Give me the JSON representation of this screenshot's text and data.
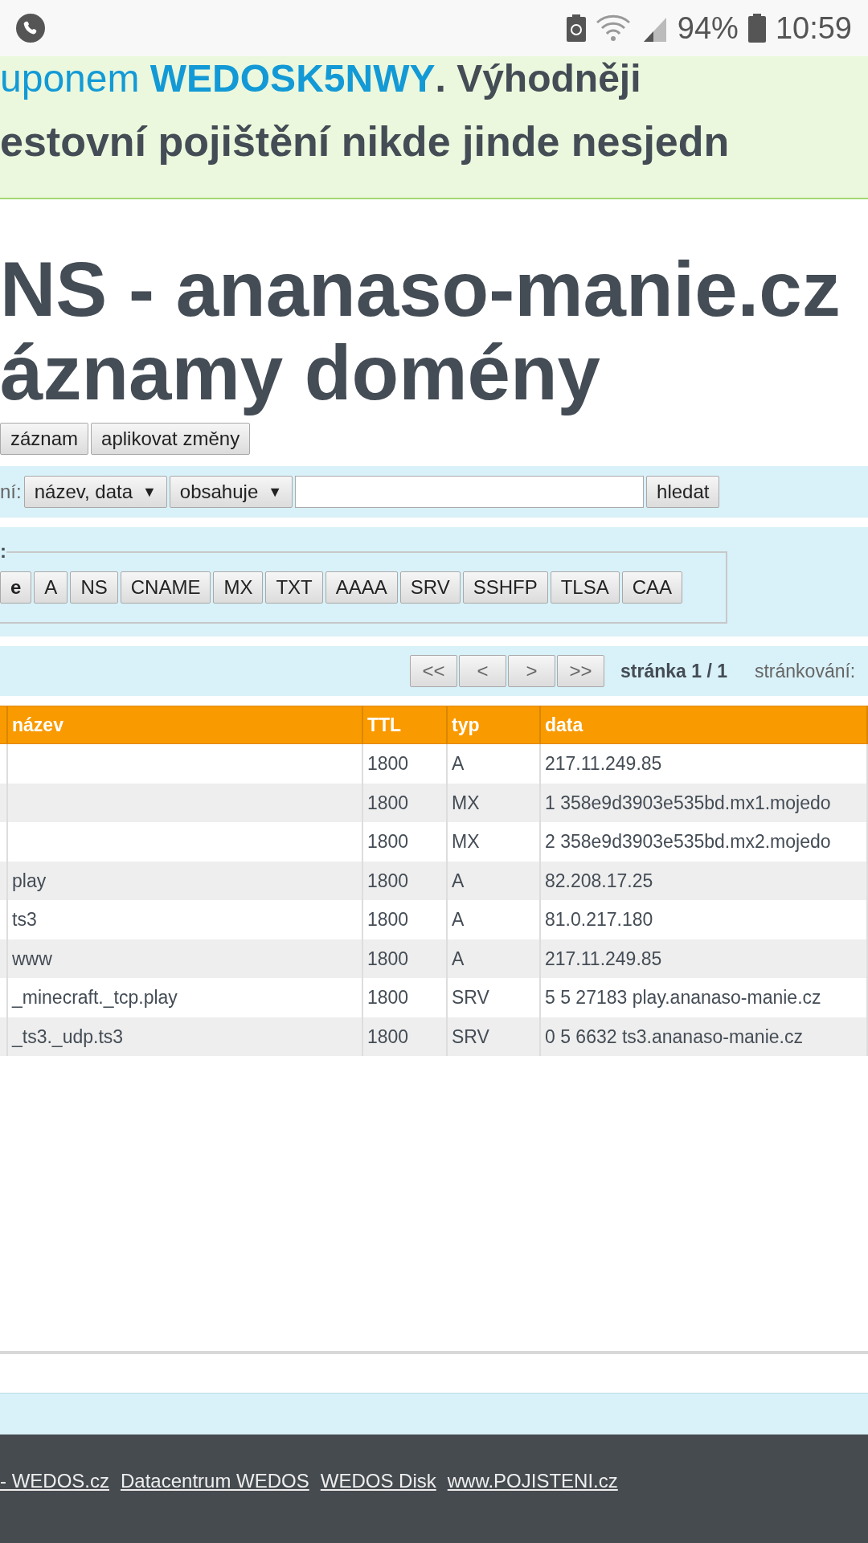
{
  "status_bar": {
    "battery_percent": "94%",
    "time": "10:59"
  },
  "banner": {
    "line_1_prefix": "uponem ",
    "coupon": "WEDOSK5NWY",
    "line_1_suffix": ". Výhodněji",
    "line_2": "estovní pojištění nikde jinde nesjedn"
  },
  "heading": {
    "line_1": "NS - ananaso-manie.cz",
    "line_2": "áznamy domény"
  },
  "actions": [
    "záznam",
    "aplikovat změny"
  ],
  "search": {
    "label": "ní:",
    "field_select": "název, data",
    "field_caret": "▼",
    "mode_select": "obsahuje",
    "mode_caret": "▼",
    "button": "hledat"
  },
  "type_filter": {
    "legend": ":",
    "types": [
      {
        "label": "e",
        "selected": true
      },
      {
        "label": "A",
        "selected": false
      },
      {
        "label": "NS",
        "selected": false
      },
      {
        "label": "CNAME",
        "selected": false
      },
      {
        "label": "MX",
        "selected": false
      },
      {
        "label": "TXT",
        "selected": false
      },
      {
        "label": "AAAA",
        "selected": false
      },
      {
        "label": "SRV",
        "selected": false
      },
      {
        "label": "SSHFP",
        "selected": false
      },
      {
        "label": "TLSA",
        "selected": false
      },
      {
        "label": "CAA",
        "selected": false
      }
    ]
  },
  "pager": {
    "buttons": [
      "<<",
      "<",
      ">",
      ">>"
    ],
    "page": "stránka 1 / 1",
    "per_page_label": "stránkování:"
  },
  "table": {
    "columns": [
      "název",
      "TTL",
      "typ",
      "data"
    ],
    "rows": [
      [
        "",
        "1800",
        "A",
        "217.11.249.85"
      ],
      [
        "",
        "1800",
        "MX",
        "1 358e9d3903e535bd.mx1.mojedo"
      ],
      [
        "",
        "1800",
        "MX",
        "2 358e9d3903e535bd.mx2.mojedo"
      ],
      [
        "play",
        "1800",
        "A",
        "82.208.17.25"
      ],
      [
        "ts3",
        "1800",
        "A",
        "81.0.217.180"
      ],
      [
        "www",
        "1800",
        "A",
        "217.11.249.85"
      ],
      [
        "_minecraft._tcp.play",
        "1800",
        "SRV",
        "5 5 27183 play.ananaso-manie.cz"
      ],
      [
        "_ts3._udp.ts3",
        "1800",
        "SRV",
        "0 5 6632 ts3.ananaso-manie.cz"
      ]
    ]
  },
  "footer_links": [
    "- WEDOS.cz",
    "Datacentrum WEDOS",
    "WEDOS Disk",
    "www.POJISTENI.cz"
  ]
}
